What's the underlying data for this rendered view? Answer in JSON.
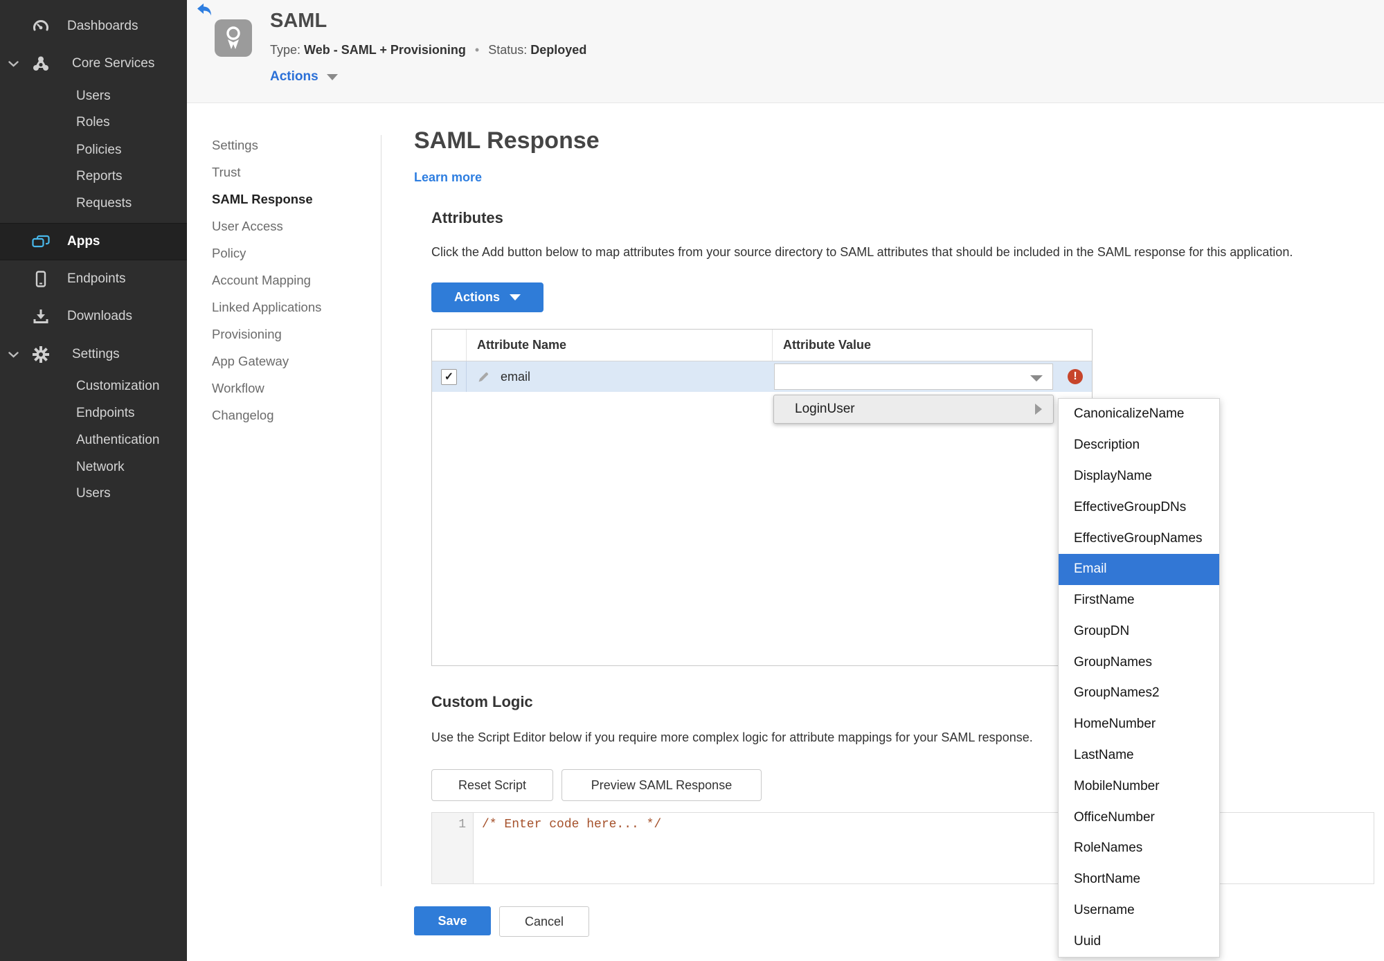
{
  "sidebar": {
    "dashboards": "Dashboards",
    "core_services": "Core Services",
    "users": "Users",
    "roles": "Roles",
    "policies": "Policies",
    "reports": "Reports",
    "requests": "Requests",
    "apps": "Apps",
    "endpoints": "Endpoints",
    "downloads": "Downloads",
    "settings": "Settings",
    "customization": "Customization",
    "endpoints2": "Endpoints",
    "authentication": "Authentication",
    "network": "Network",
    "users2": "Users"
  },
  "header": {
    "app_title": "SAML",
    "type_label": "Type:",
    "type_value": "Web - SAML + Provisioning",
    "separator": "•",
    "status_label": "Status:",
    "status_value": "Deployed",
    "actions_label": "Actions"
  },
  "subnav": {
    "items": [
      "Settings",
      "Trust",
      "SAML Response",
      "User Access",
      "Policy",
      "Account Mapping",
      "Linked Applications",
      "Provisioning",
      "App Gateway",
      "Workflow",
      "Changelog"
    ],
    "active": "SAML Response"
  },
  "main": {
    "title": "SAML Response",
    "learn_more": "Learn more",
    "attributes": {
      "heading": "Attributes",
      "description": "Click the Add button below to map attributes from your source directory to SAML attributes that should be included in the SAML response for this application.",
      "actions_button": "Actions",
      "table": {
        "columns": [
          "Attribute Name",
          "Attribute Value"
        ],
        "rows": [
          {
            "name": "email",
            "value": ""
          }
        ]
      }
    },
    "value_menu": {
      "label": "LoginUser",
      "selected": "Email",
      "submenu": [
        "CanonicalizeName",
        "Description",
        "DisplayName",
        "EffectiveGroupDNs",
        "EffectiveGroupNames",
        "Email",
        "FirstName",
        "GroupDN",
        "GroupNames",
        "GroupNames2",
        "HomeNumber",
        "LastName",
        "MobileNumber",
        "OfficeNumber",
        "RoleNames",
        "ShortName",
        "Username",
        "Uuid"
      ]
    },
    "custom_logic": {
      "heading": "Custom Logic",
      "description": "Use the Script Editor below if you require more complex logic for attribute mappings for your SAML response.",
      "reset_button": "Reset Script",
      "preview_button": "Preview SAML Response",
      "editor": {
        "line_number": "1",
        "code": "/* Enter code here... */"
      }
    },
    "save_button": "Save",
    "cancel_button": "Cancel"
  },
  "icons": {
    "check_glyph": "✓",
    "error_glyph": "!"
  },
  "colors": {
    "accent_blue": "#2f7cd8",
    "link_blue": "#2e7ee0",
    "selected_item_blue": "#3277d5",
    "row_highlight_blue": "#dce8f6",
    "status_green": "#3c8a28",
    "error_red": "#c7452b",
    "code_comment": "#a5512b",
    "sidebar_bg": "#2d2d2d",
    "apps_icon_cyan": "#49b8ea"
  }
}
